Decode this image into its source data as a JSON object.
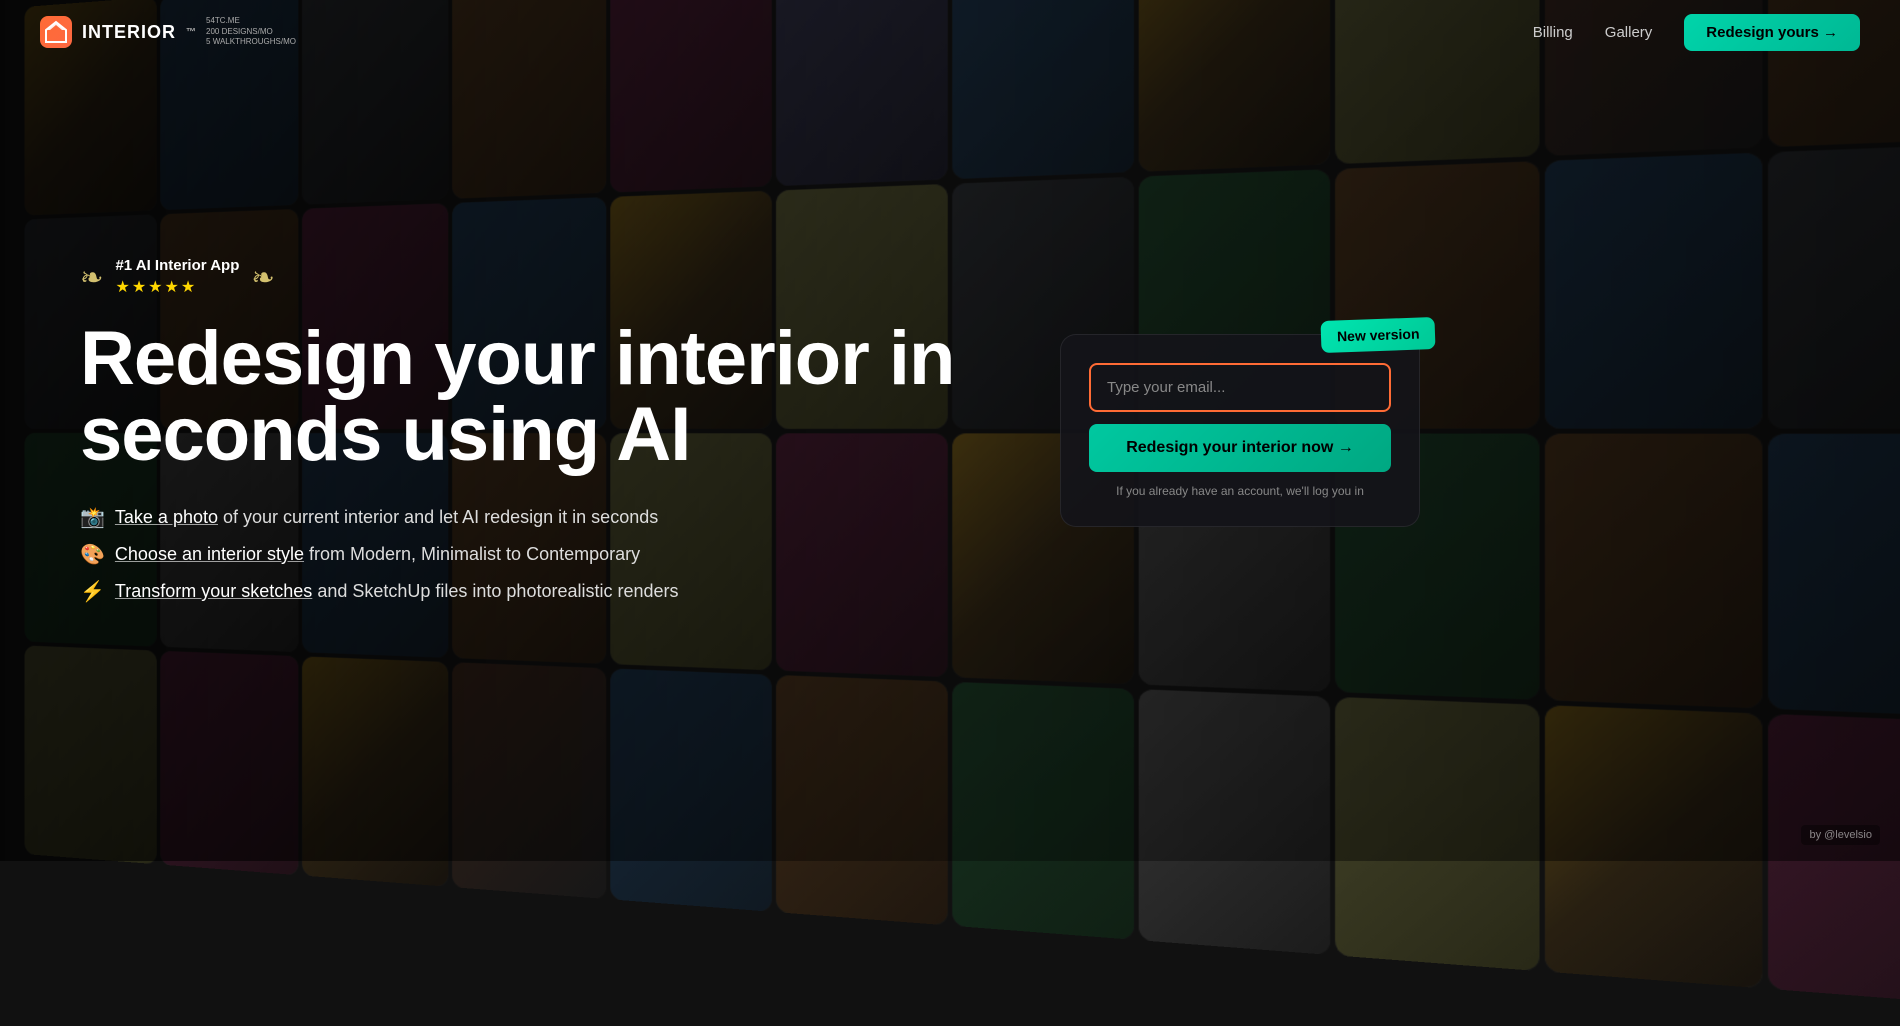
{
  "brand": {
    "logo_text": "INTERIOR",
    "logo_tm": "™",
    "badge_line1": "54TC.ME",
    "badge_line2": "200 DESIGNS/MO",
    "badge_line3": "5 WALKTHROUGHS/MO"
  },
  "nav": {
    "billing_label": "Billing",
    "gallery_label": "Gallery",
    "cta_label": "Redesign yours →"
  },
  "hero": {
    "award_text": "#1 AI Interior App",
    "stars": "★★★★★",
    "headline_line1": "Redesign your interior in",
    "headline_line2": "seconds using AI",
    "features": [
      {
        "icon": "📸",
        "link_text": "Take a photo",
        "rest": " of your current interior and let AI redesign it in seconds"
      },
      {
        "icon": "🎨",
        "link_text": "Choose an interior style",
        "rest": " from Modern, Minimalist to Contemporary"
      },
      {
        "icon": "⚡",
        "link_text": "Transform your sketches",
        "rest": " and SketchUp files into photorealistic renders"
      }
    ]
  },
  "signup_card": {
    "new_version_badge": "New version",
    "email_placeholder": "Type your email...",
    "cta_button_label": "Redesign your interior now →",
    "signin_text": "If you already have an account, we'll log you in"
  },
  "credit": {
    "text": "by @levelsio"
  },
  "colors": {
    "cta_bg": "#00c8a0",
    "badge_bg": "#00e5b0",
    "email_border": "#ff6b35",
    "accent_teal": "#00d4aa"
  }
}
